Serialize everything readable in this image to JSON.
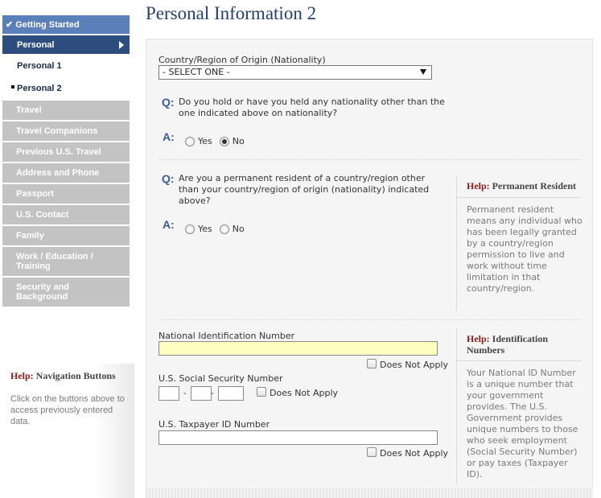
{
  "sidebar": {
    "getting_started": "Getting Started",
    "personal": "Personal",
    "personal_1": "Personal 1",
    "personal_2": "Personal 2",
    "travel": "Travel",
    "travel_companions": "Travel Companions",
    "previous_us_travel": "Previous U.S. Travel",
    "address_phone": "Address and Phone",
    "passport": "Passport",
    "us_contact": "U.S. Contact",
    "family": "Family",
    "work_education": "Work / Education / Training",
    "security_background": "Security and Background"
  },
  "nav_help": {
    "help_word": "Help:",
    "title": "Navigation Buttons",
    "text": "Click on the buttons above to access previously entered data."
  },
  "page": {
    "title": "Personal Information 2"
  },
  "form": {
    "country_label": "Country/Region of Origin (Nationality)",
    "country_selected": "- SELECT ONE -",
    "q_mark": "Q:",
    "a_mark": "A:",
    "q1_text": "Do you hold or have you held any nationality other than the one indicated above on nationality?",
    "q1_yes": "Yes",
    "q1_no": "No",
    "q2_text": "Are you a permanent resident of a country/region other than your country/region of origin (nationality) indicated above?",
    "q2_yes": "Yes",
    "q2_no": "No",
    "national_id_label": "National Identification Number",
    "does_not_apply": "Does Not Apply",
    "ssn_label": "U.S. Social Security Number",
    "ssn_sep": "-",
    "taxpayer_label": "U.S. Taxpayer ID Number"
  },
  "help_permanent": {
    "help_word": "Help:",
    "title": "Permanent Resident",
    "text": "Permanent resident means any individual who has been legally granted by a country/region permission to live and work without time limitation in that country/region."
  },
  "help_identification": {
    "help_word": "Help:",
    "title": "Identification Numbers",
    "text": "Your National ID Number is a unique number that your government provides. The U.S. Government provides unique numbers to those who seek employment (Social Security Number) or pay taxes (Taxpayer ID)."
  },
  "colors": {
    "nav_active": "#5b7fb8",
    "nav_current": "#2d4d7f",
    "nav_disabled": "#c3c3c3",
    "title": "#24406a",
    "help_word": "#8b1a1a",
    "required_field": "#ffffc0"
  }
}
